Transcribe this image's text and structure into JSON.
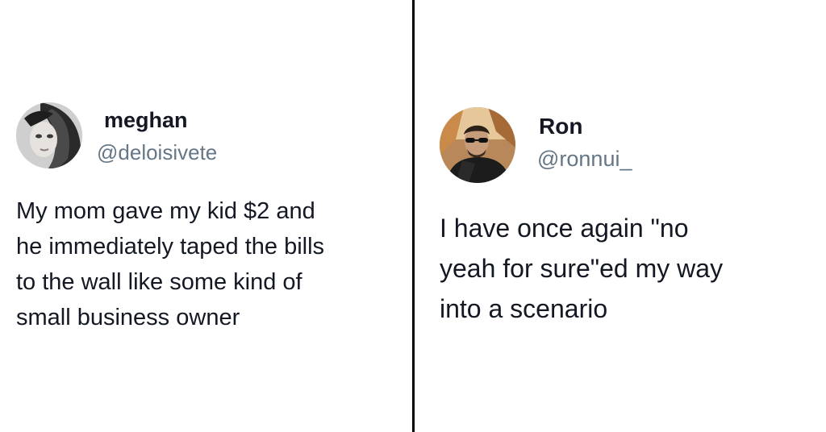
{
  "tweets": [
    {
      "display_name": "meghan",
      "handle": "@deloisivete",
      "text_lines": [
        "My mom gave my kid $2 and",
        "he immediately taped the bills",
        "to the wall like some kind of",
        "small business owner"
      ]
    },
    {
      "display_name": "Ron",
      "handle": "@ronnui_",
      "text_lines": [
        "I have once again \"no",
        "yeah for sure\"ed my way",
        "into a scenario"
      ]
    }
  ],
  "colors": {
    "name": "#141823",
    "handle": "#657786",
    "divider": "#000000",
    "background": "#ffffff"
  }
}
